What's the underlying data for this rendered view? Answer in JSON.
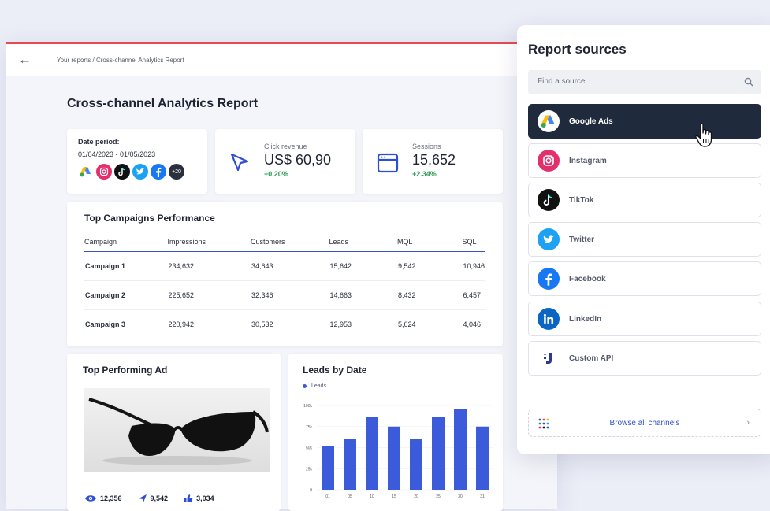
{
  "breadcrumb": "Your reports / Cross-channel Analytics Report",
  "report_title": "Cross-channel Analytics Report",
  "date_period": {
    "label": "Date period:",
    "value": "01/04/2023 - 01/05/2023",
    "more_sources": "+20"
  },
  "kpis": {
    "click_revenue": {
      "label": "Click revenue",
      "value": "US$ 60,90",
      "delta": "+0.20%"
    },
    "sessions": {
      "label": "Sessions",
      "value": "15,652",
      "delta": "+2.34%"
    }
  },
  "campaigns": {
    "title": "Top Campaigns Performance",
    "columns": [
      "Campaign",
      "Impressions",
      "Customers",
      "Leads",
      "MQL",
      "SQL"
    ],
    "rows": [
      [
        "Campaign 1",
        "234,632",
        "34,643",
        "15,642",
        "9,542",
        "10,946"
      ],
      [
        "Campaign 2",
        "225,652",
        "32,346",
        "14,663",
        "8,432",
        "6,457"
      ],
      [
        "Campaign 3",
        "220,942",
        "30,532",
        "12,953",
        "5,624",
        "4,046"
      ]
    ]
  },
  "top_ad": {
    "title": "Top Performing Ad",
    "views": "12,356",
    "clicks": "9,542",
    "likes": "3,034"
  },
  "leads_chart": {
    "title": "Leads by Date",
    "legend": "Leads",
    "bar_color": "#3b5bdb"
  },
  "chart_data": {
    "type": "bar",
    "title": "Leads by Date",
    "categories": [
      "01",
      "05",
      "10",
      "15",
      "20",
      "25",
      "30",
      "31"
    ],
    "series": [
      {
        "name": "Leads",
        "values": [
          52,
          60,
          86,
          75,
          60,
          86,
          96,
          75
        ]
      }
    ],
    "y_ticks": [
      "0",
      "25k",
      "50k",
      "75k",
      "100k"
    ],
    "ylim": [
      0,
      100
    ]
  },
  "report_sources": {
    "title": "Report sources",
    "search_placeholder": "Find a source",
    "items": [
      {
        "label": "Google Ads",
        "icon": "google-ads-icon",
        "active": true
      },
      {
        "label": "Instagram",
        "icon": "instagram-icon"
      },
      {
        "label": "TikTok",
        "icon": "tiktok-icon"
      },
      {
        "label": "Twitter",
        "icon": "twitter-icon"
      },
      {
        "label": "Facebook",
        "icon": "facebook-icon"
      },
      {
        "label": "LinkedIn",
        "icon": "linkedin-icon"
      },
      {
        "label": "Custom API",
        "icon": "custom-api-icon"
      }
    ],
    "browse_label": "Browse all channels"
  },
  "colors": {
    "accent": "#3552c7",
    "active_source_bg": "#1f2a3d",
    "positive": "#2e9b58",
    "top_border": "#e34b54"
  }
}
